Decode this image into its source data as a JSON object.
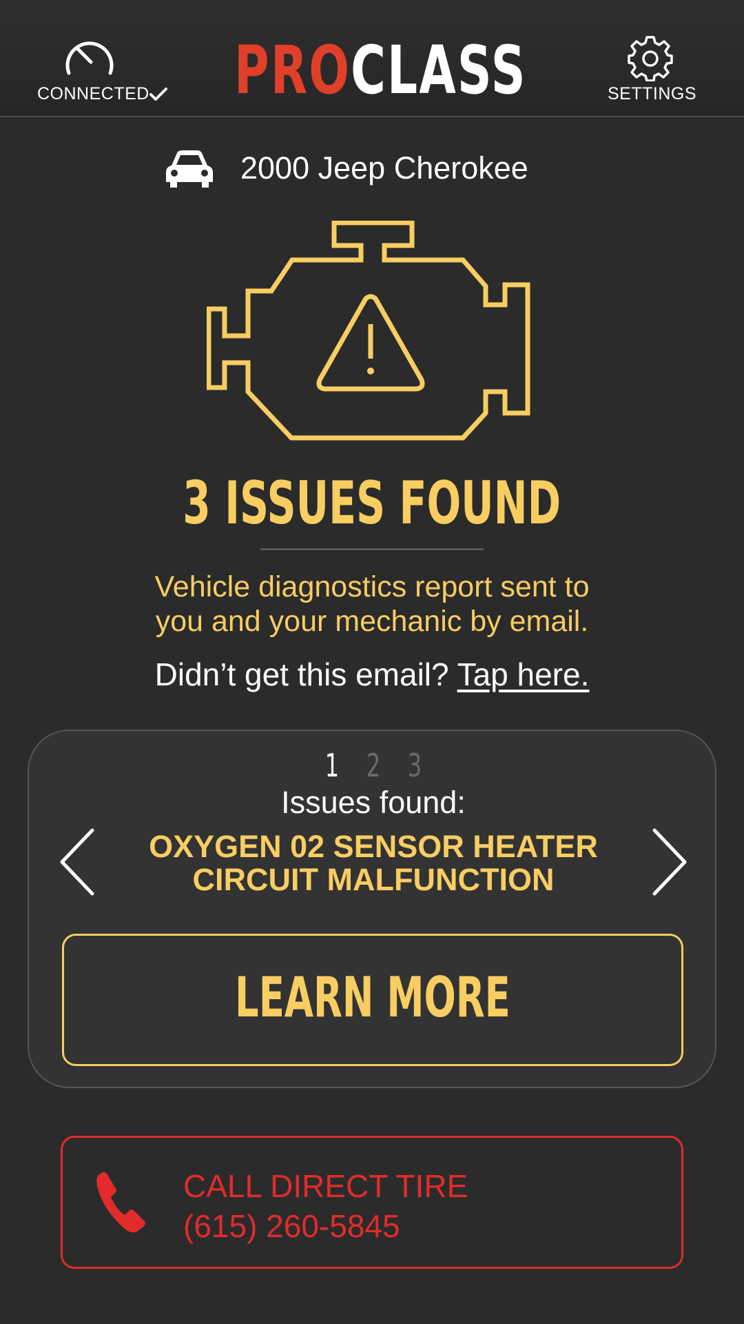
{
  "header": {
    "connection_label": "CONNECTED",
    "logo_pro": "PRO",
    "logo_class": "CLASS",
    "settings_label": "SETTINGS"
  },
  "vehicle": {
    "name": "2000 Jeep Cherokee"
  },
  "summary": {
    "issues_title": "3 ISSUES FOUND",
    "report_line1": "Vehicle diagnostics report sent to",
    "report_line2": "you and your mechanic by email.",
    "email_prompt": "Didn’t get this email?",
    "email_link": "Tap here."
  },
  "issue_card": {
    "pages": [
      "1",
      "2",
      "3"
    ],
    "current_page": 1,
    "label": "Issues found:",
    "issue_line1": "OXYGEN 02 SENSOR HEATER",
    "issue_line2": "CIRCUIT MALFUNCTION",
    "learn_more_label": "LEARN MORE"
  },
  "call": {
    "line1": "CALL DIRECT TIRE",
    "line2": "(615) 260-5845"
  },
  "colors": {
    "background": "#2b2b2b",
    "accent_yellow": "#f8cd62",
    "logo_red": "#e0402a",
    "call_red": "#e22b2b"
  },
  "icons": {
    "connection": "gauge-icon",
    "connected_status": "checkmark-icon",
    "settings": "gear-icon",
    "vehicle": "car-icon",
    "status": "check-engine-warning-icon",
    "prev": "chevron-left-icon",
    "next": "chevron-right-icon",
    "call": "phone-icon"
  }
}
